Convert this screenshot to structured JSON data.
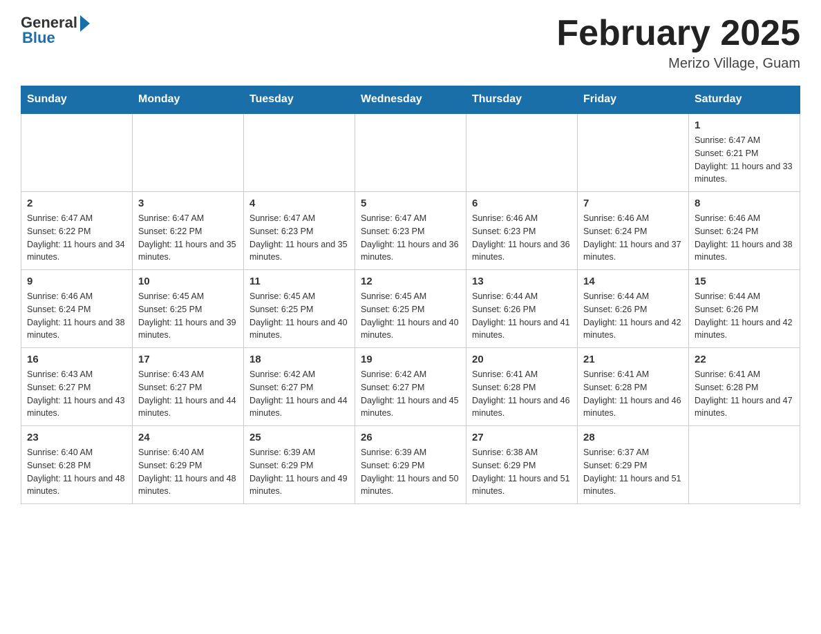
{
  "header": {
    "logo_general": "General",
    "logo_blue": "Blue",
    "month_title": "February 2025",
    "location": "Merizo Village, Guam"
  },
  "days_of_week": [
    "Sunday",
    "Monday",
    "Tuesday",
    "Wednesday",
    "Thursday",
    "Friday",
    "Saturday"
  ],
  "weeks": [
    {
      "days": [
        {
          "date": "",
          "sunrise": "",
          "sunset": "",
          "daylight": ""
        },
        {
          "date": "",
          "sunrise": "",
          "sunset": "",
          "daylight": ""
        },
        {
          "date": "",
          "sunrise": "",
          "sunset": "",
          "daylight": ""
        },
        {
          "date": "",
          "sunrise": "",
          "sunset": "",
          "daylight": ""
        },
        {
          "date": "",
          "sunrise": "",
          "sunset": "",
          "daylight": ""
        },
        {
          "date": "",
          "sunrise": "",
          "sunset": "",
          "daylight": ""
        },
        {
          "date": "1",
          "sunrise": "Sunrise: 6:47 AM",
          "sunset": "Sunset: 6:21 PM",
          "daylight": "Daylight: 11 hours and 33 minutes."
        }
      ]
    },
    {
      "days": [
        {
          "date": "2",
          "sunrise": "Sunrise: 6:47 AM",
          "sunset": "Sunset: 6:22 PM",
          "daylight": "Daylight: 11 hours and 34 minutes."
        },
        {
          "date": "3",
          "sunrise": "Sunrise: 6:47 AM",
          "sunset": "Sunset: 6:22 PM",
          "daylight": "Daylight: 11 hours and 35 minutes."
        },
        {
          "date": "4",
          "sunrise": "Sunrise: 6:47 AM",
          "sunset": "Sunset: 6:23 PM",
          "daylight": "Daylight: 11 hours and 35 minutes."
        },
        {
          "date": "5",
          "sunrise": "Sunrise: 6:47 AM",
          "sunset": "Sunset: 6:23 PM",
          "daylight": "Daylight: 11 hours and 36 minutes."
        },
        {
          "date": "6",
          "sunrise": "Sunrise: 6:46 AM",
          "sunset": "Sunset: 6:23 PM",
          "daylight": "Daylight: 11 hours and 36 minutes."
        },
        {
          "date": "7",
          "sunrise": "Sunrise: 6:46 AM",
          "sunset": "Sunset: 6:24 PM",
          "daylight": "Daylight: 11 hours and 37 minutes."
        },
        {
          "date": "8",
          "sunrise": "Sunrise: 6:46 AM",
          "sunset": "Sunset: 6:24 PM",
          "daylight": "Daylight: 11 hours and 38 minutes."
        }
      ]
    },
    {
      "days": [
        {
          "date": "9",
          "sunrise": "Sunrise: 6:46 AM",
          "sunset": "Sunset: 6:24 PM",
          "daylight": "Daylight: 11 hours and 38 minutes."
        },
        {
          "date": "10",
          "sunrise": "Sunrise: 6:45 AM",
          "sunset": "Sunset: 6:25 PM",
          "daylight": "Daylight: 11 hours and 39 minutes."
        },
        {
          "date": "11",
          "sunrise": "Sunrise: 6:45 AM",
          "sunset": "Sunset: 6:25 PM",
          "daylight": "Daylight: 11 hours and 40 minutes."
        },
        {
          "date": "12",
          "sunrise": "Sunrise: 6:45 AM",
          "sunset": "Sunset: 6:25 PM",
          "daylight": "Daylight: 11 hours and 40 minutes."
        },
        {
          "date": "13",
          "sunrise": "Sunrise: 6:44 AM",
          "sunset": "Sunset: 6:26 PM",
          "daylight": "Daylight: 11 hours and 41 minutes."
        },
        {
          "date": "14",
          "sunrise": "Sunrise: 6:44 AM",
          "sunset": "Sunset: 6:26 PM",
          "daylight": "Daylight: 11 hours and 42 minutes."
        },
        {
          "date": "15",
          "sunrise": "Sunrise: 6:44 AM",
          "sunset": "Sunset: 6:26 PM",
          "daylight": "Daylight: 11 hours and 42 minutes."
        }
      ]
    },
    {
      "days": [
        {
          "date": "16",
          "sunrise": "Sunrise: 6:43 AM",
          "sunset": "Sunset: 6:27 PM",
          "daylight": "Daylight: 11 hours and 43 minutes."
        },
        {
          "date": "17",
          "sunrise": "Sunrise: 6:43 AM",
          "sunset": "Sunset: 6:27 PM",
          "daylight": "Daylight: 11 hours and 44 minutes."
        },
        {
          "date": "18",
          "sunrise": "Sunrise: 6:42 AM",
          "sunset": "Sunset: 6:27 PM",
          "daylight": "Daylight: 11 hours and 44 minutes."
        },
        {
          "date": "19",
          "sunrise": "Sunrise: 6:42 AM",
          "sunset": "Sunset: 6:27 PM",
          "daylight": "Daylight: 11 hours and 45 minutes."
        },
        {
          "date": "20",
          "sunrise": "Sunrise: 6:41 AM",
          "sunset": "Sunset: 6:28 PM",
          "daylight": "Daylight: 11 hours and 46 minutes."
        },
        {
          "date": "21",
          "sunrise": "Sunrise: 6:41 AM",
          "sunset": "Sunset: 6:28 PM",
          "daylight": "Daylight: 11 hours and 46 minutes."
        },
        {
          "date": "22",
          "sunrise": "Sunrise: 6:41 AM",
          "sunset": "Sunset: 6:28 PM",
          "daylight": "Daylight: 11 hours and 47 minutes."
        }
      ]
    },
    {
      "days": [
        {
          "date": "23",
          "sunrise": "Sunrise: 6:40 AM",
          "sunset": "Sunset: 6:28 PM",
          "daylight": "Daylight: 11 hours and 48 minutes."
        },
        {
          "date": "24",
          "sunrise": "Sunrise: 6:40 AM",
          "sunset": "Sunset: 6:29 PM",
          "daylight": "Daylight: 11 hours and 48 minutes."
        },
        {
          "date": "25",
          "sunrise": "Sunrise: 6:39 AM",
          "sunset": "Sunset: 6:29 PM",
          "daylight": "Daylight: 11 hours and 49 minutes."
        },
        {
          "date": "26",
          "sunrise": "Sunrise: 6:39 AM",
          "sunset": "Sunset: 6:29 PM",
          "daylight": "Daylight: 11 hours and 50 minutes."
        },
        {
          "date": "27",
          "sunrise": "Sunrise: 6:38 AM",
          "sunset": "Sunset: 6:29 PM",
          "daylight": "Daylight: 11 hours and 51 minutes."
        },
        {
          "date": "28",
          "sunrise": "Sunrise: 6:37 AM",
          "sunset": "Sunset: 6:29 PM",
          "daylight": "Daylight: 11 hours and 51 minutes."
        },
        {
          "date": "",
          "sunrise": "",
          "sunset": "",
          "daylight": ""
        }
      ]
    }
  ]
}
